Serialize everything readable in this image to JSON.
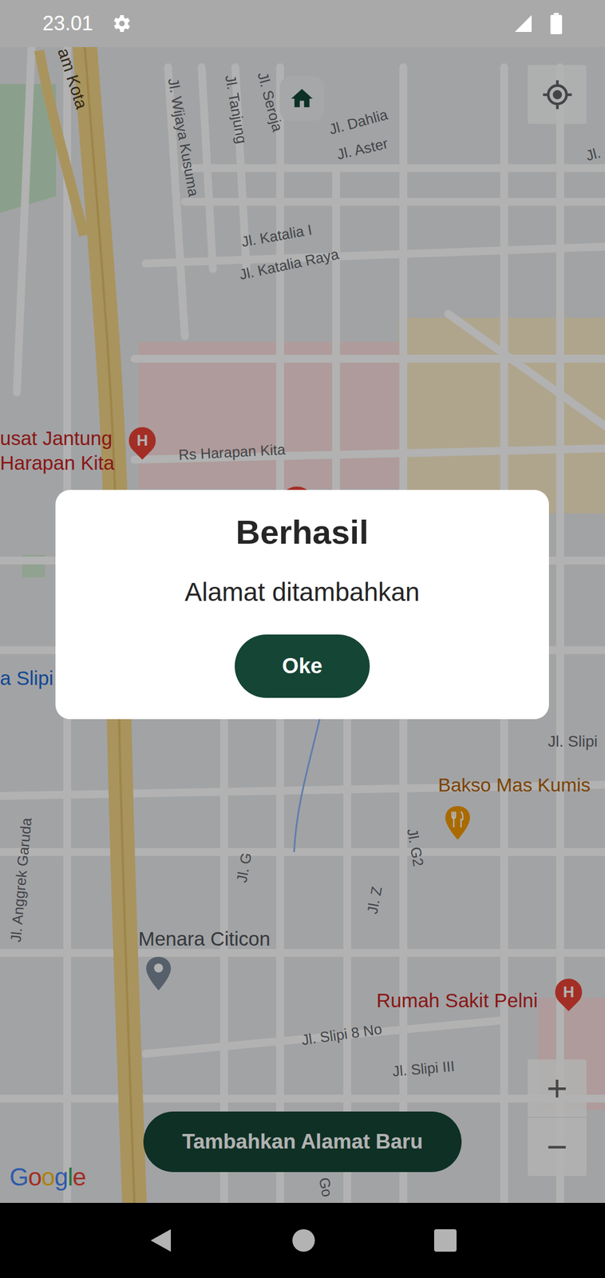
{
  "status_bar": {
    "time": "23.01"
  },
  "map": {
    "labels": [
      {
        "text": "am Kota",
        "color": "#4a3c1c"
      },
      {
        "text": "Jl. Wijaya Kusuma",
        "color": "#5f6368"
      },
      {
        "text": "Jl. Tanjung",
        "color": "#5f6368"
      },
      {
        "text": "Jl. Seroja",
        "color": "#5f6368"
      },
      {
        "text": "Jl. Dahlia",
        "color": "#5f6368"
      },
      {
        "text": "Jl. Aster",
        "color": "#5f6368"
      },
      {
        "text": "Jl.",
        "color": "#5f6368"
      },
      {
        "text": "Jl. Katalia I",
        "color": "#5f6368"
      },
      {
        "text": "Jl. Katalia Raya",
        "color": "#5f6368"
      },
      {
        "text": "usat Jantung",
        "color": "#c5221f"
      },
      {
        "text": "Harapan Kita",
        "color": "#c5221f"
      },
      {
        "text": "Rs Harapan Kita",
        "color": "#5f6368"
      },
      {
        "text": "a Slipi",
        "color": "#1967d2"
      },
      {
        "text": "Jl. Slipi",
        "color": "#5f6368"
      },
      {
        "text": "Bakso Mas Kumis",
        "color": "#b06000"
      },
      {
        "text": "Jl. G2",
        "color": "#5f6368"
      },
      {
        "text": "Jl. G",
        "color": "#5f6368"
      },
      {
        "text": "Jl. Z",
        "color": "#5f6368"
      },
      {
        "text": "Jl. Anggrek Garuda",
        "color": "#5f6368"
      },
      {
        "text": "Menara Citicon",
        "color": "#4d5156"
      },
      {
        "text": "Rumah Sakit Pelni",
        "color": "#c5221f"
      },
      {
        "text": "Jl. Slipi 8 No",
        "color": "#5f6368"
      },
      {
        "text": "Jl. Slipi III",
        "color": "#5f6368"
      },
      {
        "text": "Go",
        "color": "#5f6368"
      }
    ],
    "pins": [
      {
        "glyph": "H",
        "color": "#ea4335"
      },
      {
        "glyph": "H",
        "color": "#ea4335"
      }
    ],
    "attribution": "Google"
  },
  "controls": {
    "zoom_in": "+",
    "zoom_out": "−"
  },
  "primary_button": "Tambahkan Alamat Baru",
  "dialog": {
    "title": "Berhasil",
    "message": "Alamat ditambahkan",
    "button": "Oke"
  }
}
